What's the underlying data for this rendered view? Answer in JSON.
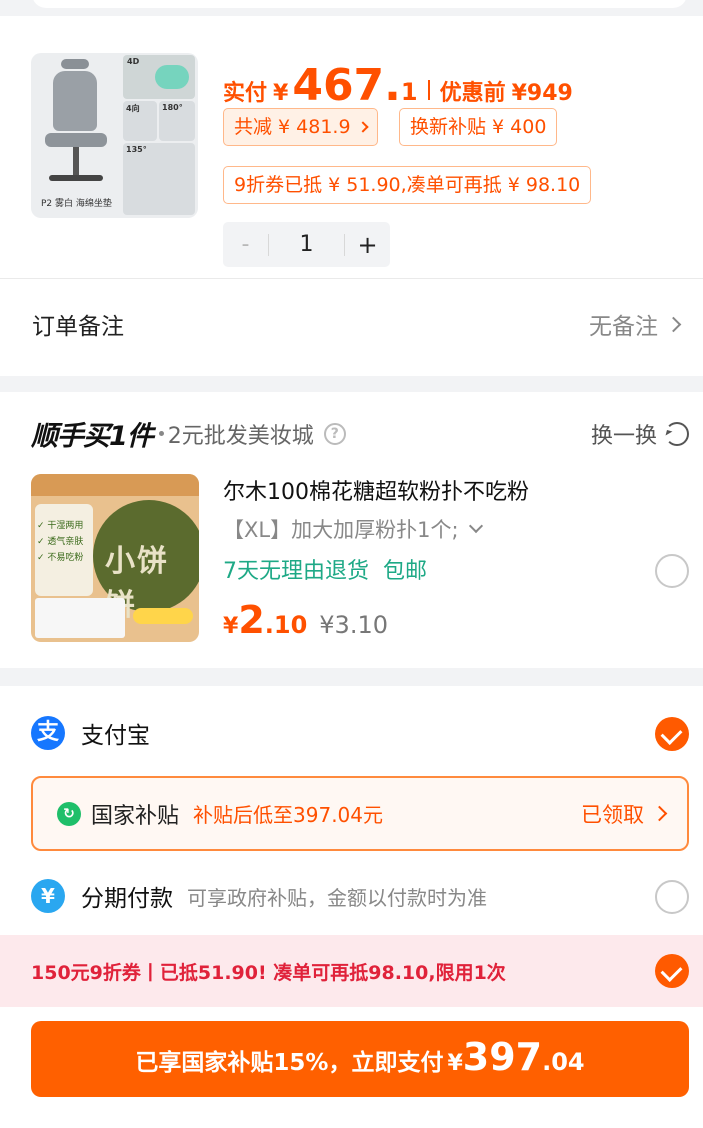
{
  "product": {
    "image_caption": "P2 雾白 海绵坐垫",
    "image_labels": [
      "4D",
      "4向",
      "180°",
      "135°"
    ],
    "price_label": "实付",
    "price_yen": "¥",
    "price_int": "467.",
    "price_dec": "1",
    "orig_label": "优惠前",
    "orig_price": "¥949",
    "total_discount": "共减 ¥ 481.9",
    "trade_in": "换新补贴 ¥ 400",
    "coupon_info": "9折券已抵 ¥ 51.90,凑单可再抵 ¥ 98.10",
    "qty_minus": "-",
    "quantity": "1",
    "qty_plus": "+"
  },
  "remark": {
    "label": "订单备注",
    "value": "无备注"
  },
  "shunshou": {
    "title": "顺手买1件",
    "subtitle": "2元批发美妆城",
    "help_icon": "?",
    "switch_label": "换一换",
    "item": {
      "name": "尔木100棉花糖超软粉扑不吃粉",
      "spec": "【XL】加大加厚粉扑1个;",
      "service_1": "7天无理由退货",
      "service_2": "包邮",
      "price_yen": "¥",
      "price_int": "2",
      "price_dec": ".10",
      "orig_price": "¥3.10",
      "image_text": "小饼饼",
      "image_checks": [
        "✓ 干湿两用",
        "✓ 透气亲肤",
        "✓ 不易吃粉"
      ]
    }
  },
  "payment": {
    "alipay_icon": "支",
    "alipay_label": "支付宝",
    "subsidy_icon": "↻",
    "subsidy_name": "国家补贴",
    "subsidy_desc": "补贴后低至397.04元",
    "subsidy_claimed": "已领取",
    "installment_icon": "¥",
    "installment_label": "分期付款",
    "installment_desc": "可享政府补贴，金额以付款时为准",
    "promo_text": "150元9折券丨已抵51.90! 凑单可再抵98.10,限用1次",
    "pay_button_text": "已享国家补贴15%，立即支付",
    "pay_button_yen": "¥",
    "pay_button_int": "397",
    "pay_button_dec": ".04"
  },
  "colors": {
    "accent": "#ff5000",
    "button": "#ff6000",
    "service_green": "#1ea986",
    "promo_bg": "#fde9ec",
    "promo_text": "#e0223a",
    "alipay_blue": "#1677ff"
  }
}
